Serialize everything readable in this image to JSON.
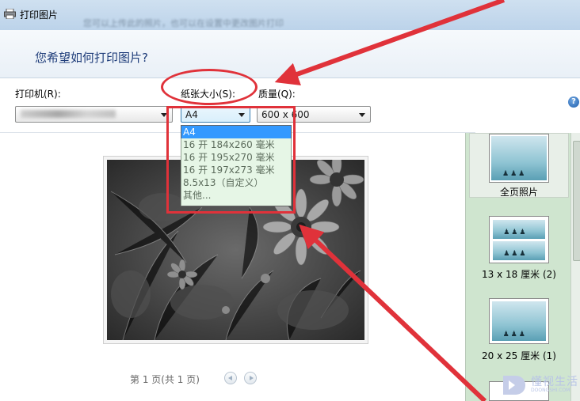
{
  "window": {
    "title": "打印图片",
    "title_blur": "您可以上传此的照片，也可以在设置中更改图片打印"
  },
  "header": {
    "heading": "您希望如何打印图片?"
  },
  "printer": {
    "label": "打印机(R):",
    "value": ""
  },
  "paper_size": {
    "label": "纸张大小(S):",
    "value": "A4",
    "options": [
      "A4",
      "16 开 184x260 毫米",
      "16 开 195x270 毫米",
      "16 开 197x273 毫米",
      "8.5x13（自定义）",
      "其他..."
    ],
    "selected_index": 0
  },
  "quality": {
    "label": "质量(Q):",
    "value": "600 x 600"
  },
  "help": {
    "glyph": "?"
  },
  "pager": {
    "text": "第 1 页(共 1 页)"
  },
  "layouts": [
    {
      "label": "全页照片",
      "selected": true
    },
    {
      "label": "13 x 18 厘米 (2)",
      "selected": false
    },
    {
      "label": "20 x 25 厘米 (1)",
      "selected": false
    }
  ],
  "watermark": {
    "text": "懂视生活",
    "sub": "DOONGSHI.COM"
  },
  "colors": {
    "annotation": "#e0323a",
    "selection": "#3399ff",
    "layout_pane": "#cfe5cf"
  }
}
